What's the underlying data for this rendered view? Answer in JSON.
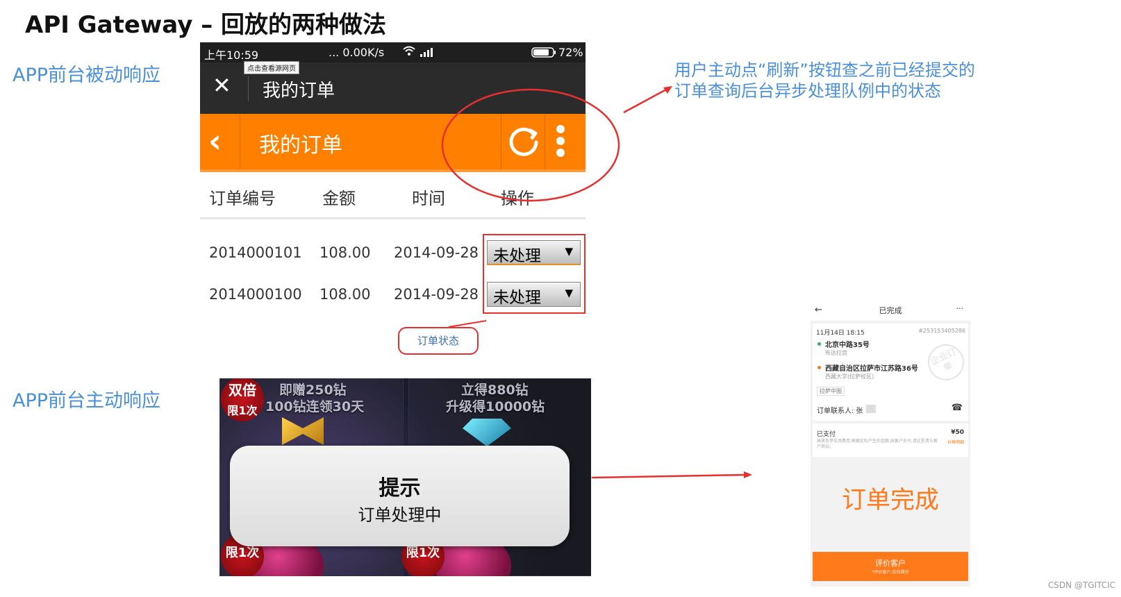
{
  "slide": {
    "title": "API Gateway – 回放的两种做法",
    "label_passive": "APP前台被动响应",
    "label_active": "APP前台主动响应",
    "annotation": "用户主动点“刷新”按钮查之前已经提交的订单查询后台异步处理队例中的状态",
    "watermark": "CSDN @TGITCIC",
    "colors": {
      "accent_blue": "#4a90d9",
      "annotation_red": "#e53030",
      "orange": "#ff8000"
    }
  },
  "phone_passive": {
    "status": {
      "time": "上午10:59",
      "network": "... 0.00K/s",
      "battery": "72%"
    },
    "tooltip": "点击查看源网页",
    "topbar_title": "我的订单",
    "header_title": "我的订单",
    "icons": [
      "close-icon",
      "back-icon",
      "refresh-icon",
      "more-icon",
      "wifi-icon",
      "signal-icon",
      "battery-icon"
    ],
    "columns": [
      "订单编号",
      "金额",
      "时间",
      "操作"
    ],
    "rows": [
      {
        "id": "2014000101",
        "amount": "108.00",
        "date": "2014-09-28",
        "status": "未处理"
      },
      {
        "id": "2014000100",
        "amount": "108.00",
        "date": "2014-09-28",
        "status": "未处理"
      }
    ],
    "callout": "订单状态"
  },
  "game_screen": {
    "banner_left_1": "即赠250钻",
    "banner_left_2": "100钻连领30天",
    "banner_right_1": "立得880钻",
    "banner_right_2": "升级得10000钻",
    "badge_top": {
      "line1": "双倍",
      "line2": "限1次"
    },
    "badge_bottom": "限1次",
    "dialog_title": "提示",
    "dialog_message": "订单处理中"
  },
  "phone_order": {
    "header_title": "已完成",
    "header_more": "···",
    "time": "11月14日 18:15",
    "order_no": "#253153405286",
    "from_address": "北京中路35号",
    "from_sub": "布达拉宫",
    "to_address": "西藏自治区拉萨市江苏路36号",
    "to_sub": "西藏大学(拉萨校区)",
    "city_tag": "拉萨中图",
    "contact_label": "订单联系人: 张",
    "paid_label": "已支付",
    "paid_amount": "¥50",
    "paid_note": "高速及停车场费用,根据实际产生的金额,由客户支付,请这里请与客户商议。",
    "price_detail": "价格明细",
    "stamp": "企业订单",
    "big_status": "订单完成",
    "button_label": "评价客户",
    "button_sub": "*评价客户,给你满分"
  }
}
